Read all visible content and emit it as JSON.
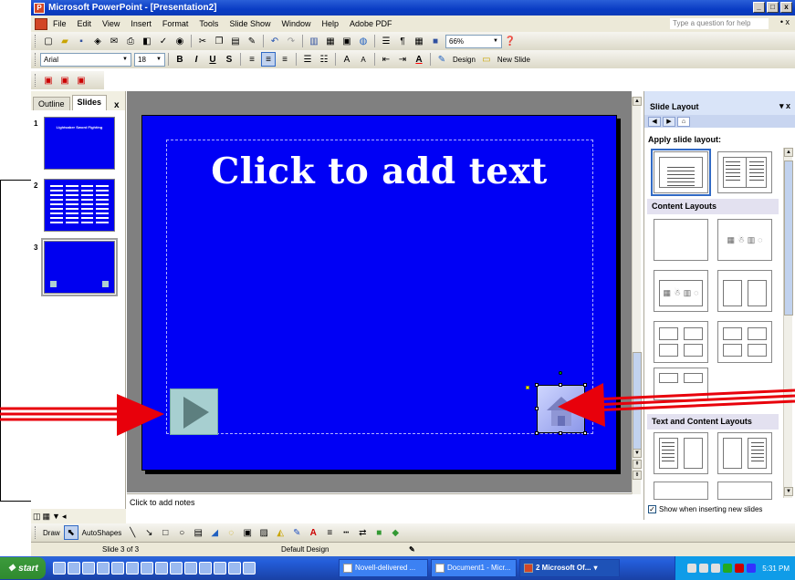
{
  "window": {
    "title": "Microsoft PowerPoint - [Presentation2]",
    "min": "_",
    "restore": "□",
    "close": "x"
  },
  "menu": {
    "items": [
      "File",
      "Edit",
      "View",
      "Insert",
      "Format",
      "Tools",
      "Slide Show",
      "Window",
      "Help",
      "Adobe PDF"
    ],
    "help_placeholder": "Type a question for help",
    "doc_close": "• x"
  },
  "standard_toolbar": {
    "zoom": "66%"
  },
  "formatting_toolbar": {
    "font": "Arial",
    "size": "18",
    "bold": "B",
    "italic": "I",
    "underline": "U",
    "shadow": "S",
    "font_color": "A",
    "design_label": "Design",
    "new_slide_label": "New Slide"
  },
  "left_panel": {
    "tabs": [
      "Outline",
      "Slides"
    ],
    "close": "x",
    "slides": [
      {
        "num": "1",
        "title": "Lightsaber Sword Fighting"
      },
      {
        "num": "2",
        "title": ""
      },
      {
        "num": "3",
        "title": ""
      }
    ]
  },
  "slide": {
    "title": "Click to add text",
    "accent": "#0000f5"
  },
  "notes": {
    "placeholder": "Click to add notes"
  },
  "task_pane": {
    "title": "Slide Layout",
    "header_controls": "▾  x",
    "apply_label": "Apply slide layout:",
    "sections": [
      "Content Layouts",
      "Text and Content Layouts"
    ],
    "show_checkbox_label": "Show when inserting new slides",
    "show_checked": true
  },
  "draw_toolbar": {
    "draw_label": "Draw",
    "autoshapes_label": "AutoShapes"
  },
  "status_bar": {
    "slide_info": "Slide 3 of 3",
    "design": "Default Design"
  },
  "taskbar": {
    "start_label": "start",
    "tasks": [
      {
        "label": "Novell-delivered ...",
        "active": false
      },
      {
        "label": "Document1 - Micr...",
        "active": false
      },
      {
        "label": "2 Microsoft Of...",
        "active": true
      }
    ],
    "clock": "5:31 PM"
  },
  "colors": {
    "arrow": "#e8000b",
    "slide_bg": "#0000f5",
    "button_fill": "#a7cfd0"
  }
}
